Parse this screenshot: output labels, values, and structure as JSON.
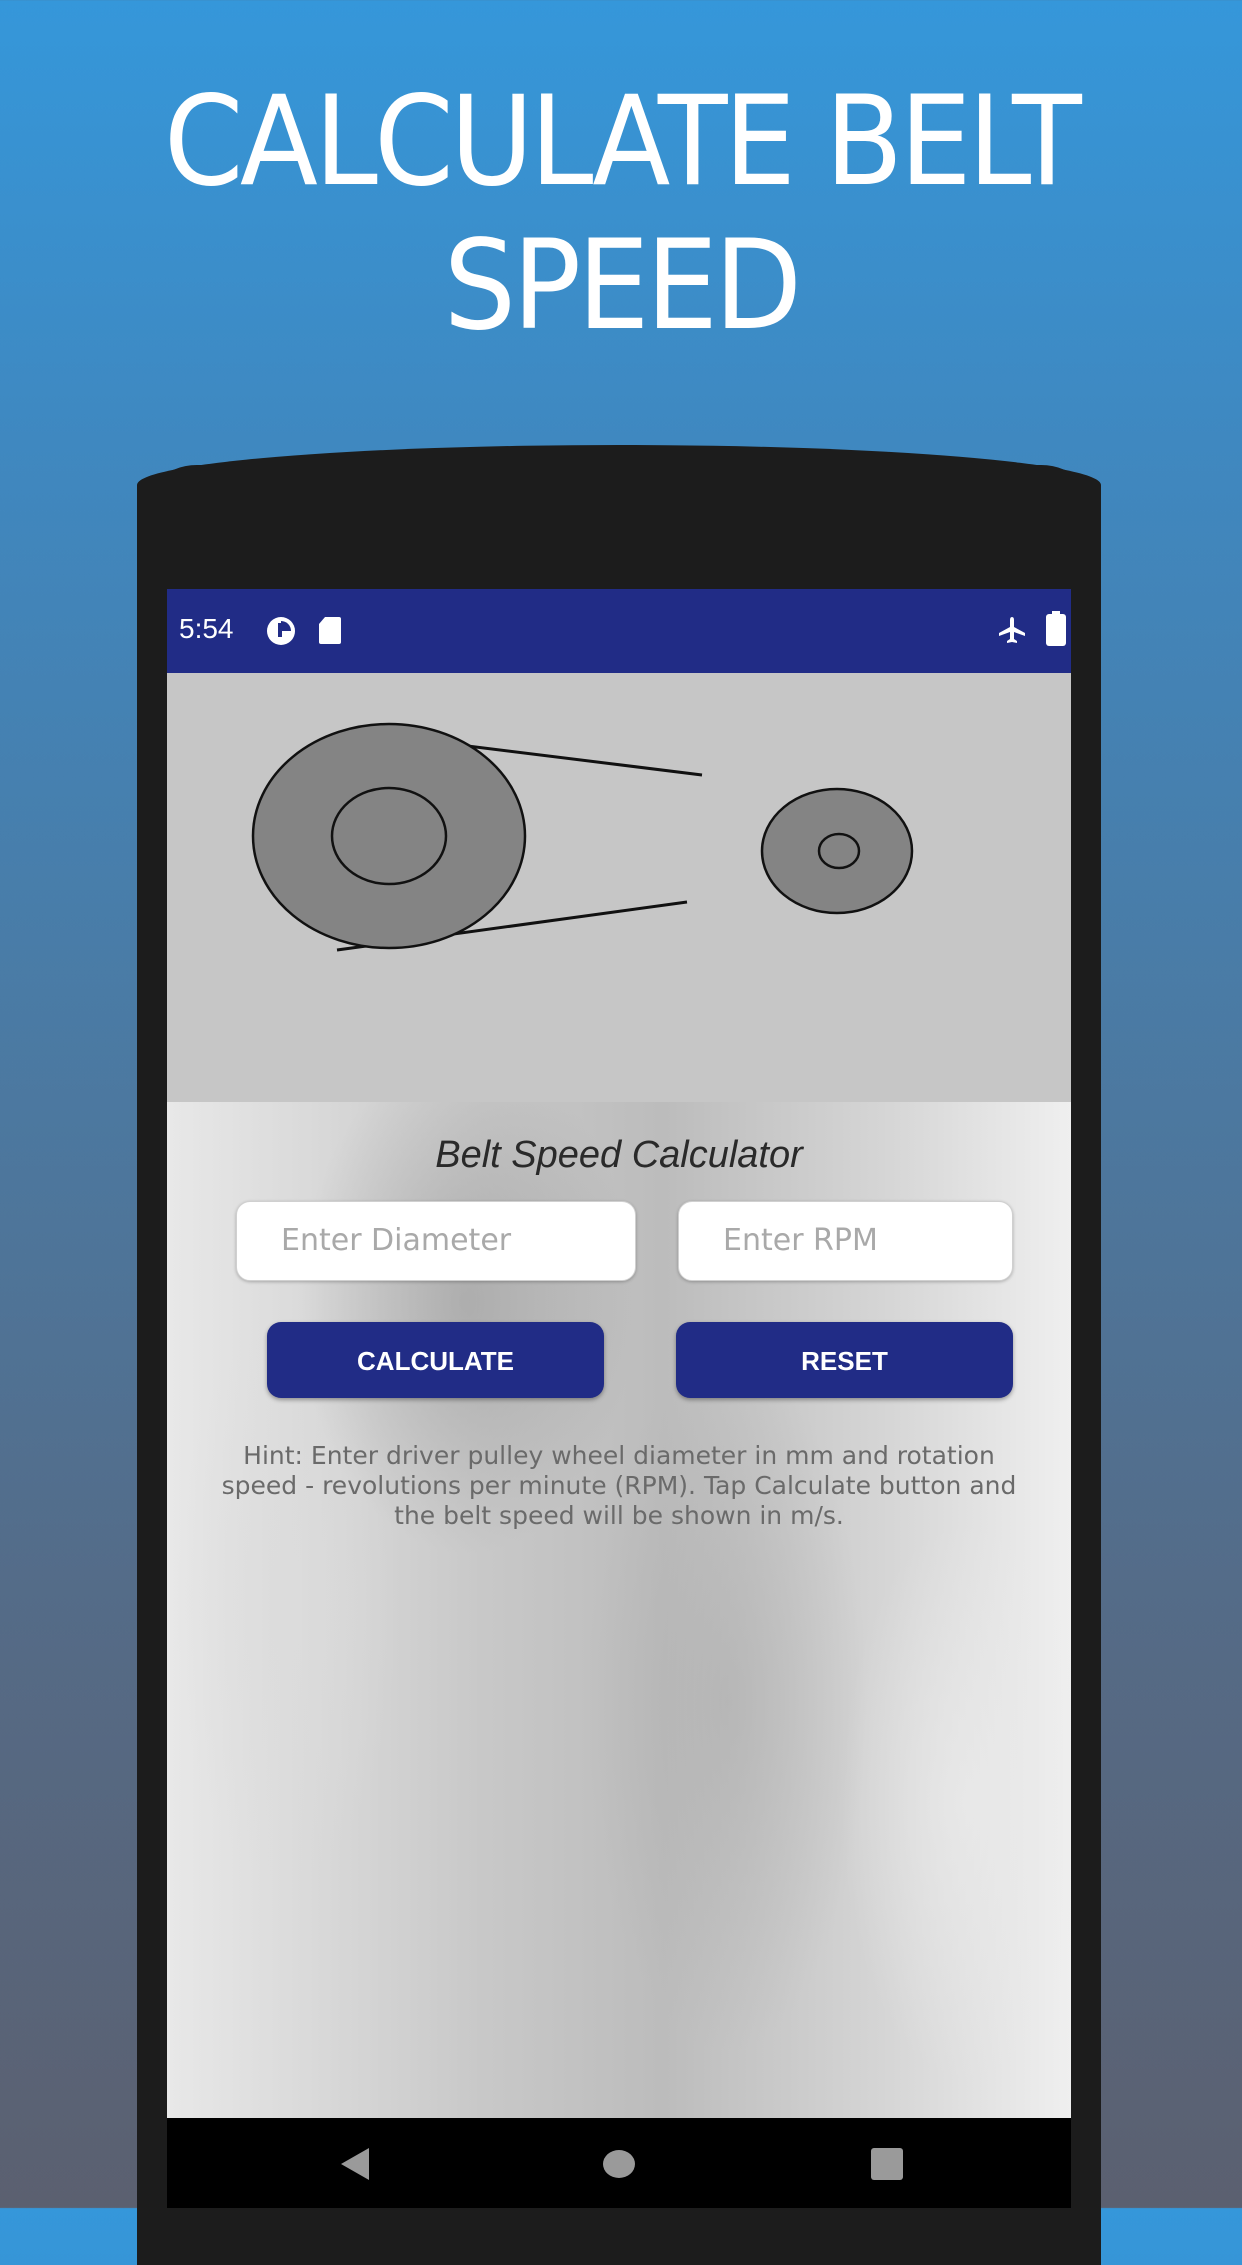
{
  "promo": {
    "title_line1": "CALCULATE BELT",
    "title_line2": "SPEED",
    "background_top_color": "#3597da",
    "background_bottom_color": "#5b6070"
  },
  "status_bar": {
    "time": "5:54",
    "left_icons": [
      "data-saver-icon",
      "sd-card-icon"
    ],
    "right_icons": [
      "airplane-mode-icon",
      "battery-icon"
    ],
    "color": "#212c86"
  },
  "header_image": {
    "description": "belt-drive-pulley-illustration"
  },
  "calculator": {
    "title": "Belt Speed Calculator",
    "diameter_input": {
      "placeholder": "Enter Diameter",
      "value": ""
    },
    "rpm_input": {
      "placeholder": "Enter RPM",
      "value": ""
    },
    "calculate_label": "CALCULATE",
    "reset_label": "RESET",
    "hint": "Hint: Enter driver pulley wheel diameter in mm and rotation speed - revolutions per minute (RPM). Tap Calculate button and the belt speed will be shown in m/s.",
    "accent_color": "#212c86"
  },
  "nav_bar": {
    "back": "back-icon",
    "home": "home-icon",
    "recents": "recents-icon"
  }
}
